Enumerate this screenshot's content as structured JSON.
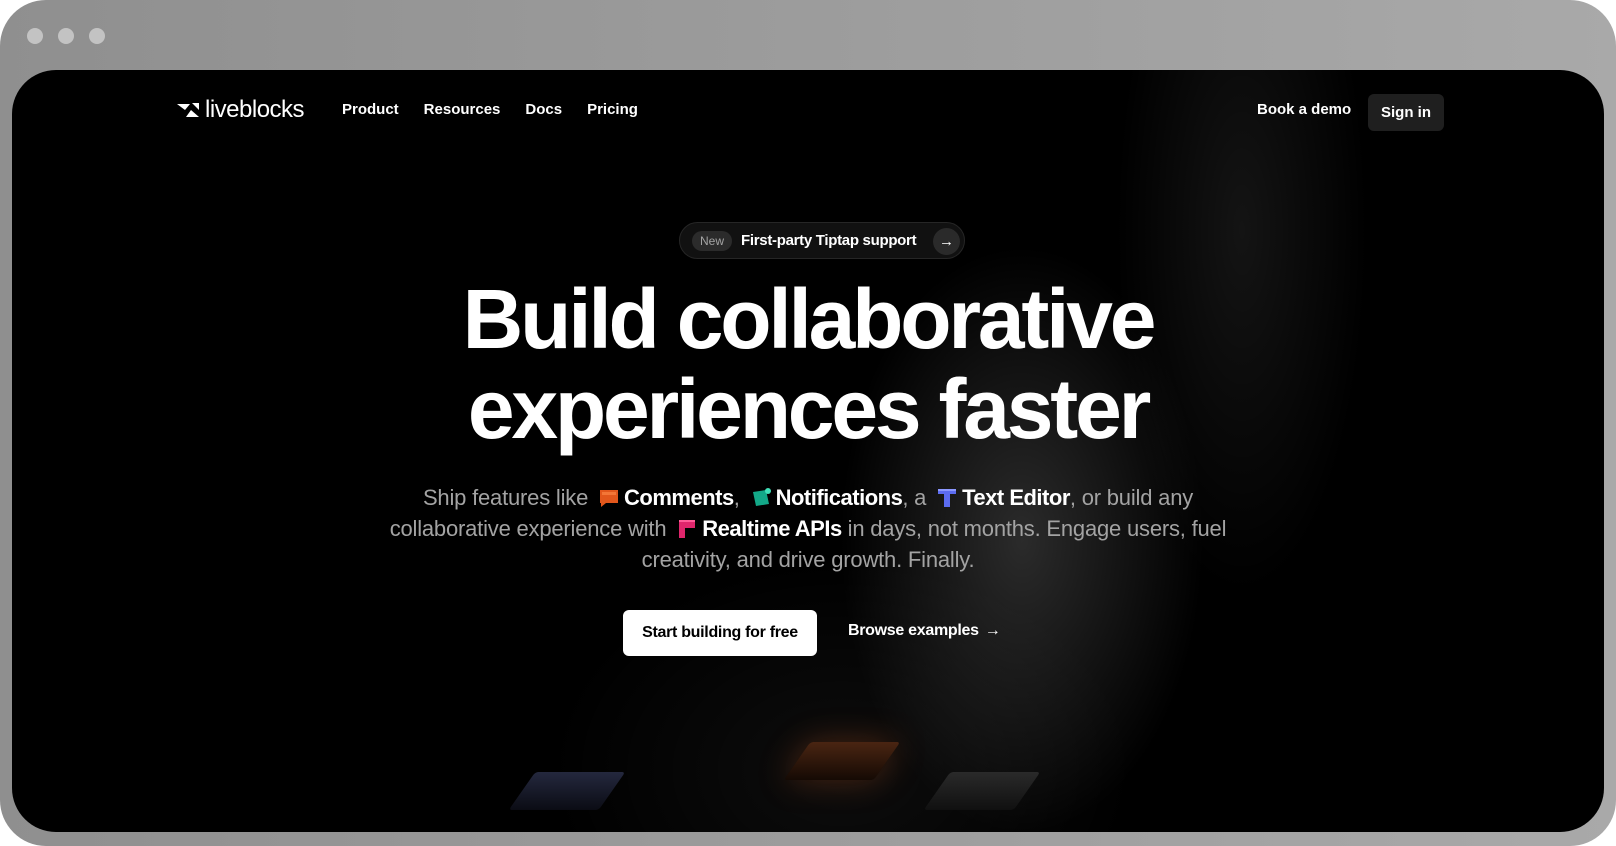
{
  "brand": {
    "name": "liveblocks"
  },
  "nav": {
    "links": [
      "Product",
      "Resources",
      "Docs",
      "Pricing"
    ],
    "book_demo": "Book a demo",
    "sign_in": "Sign in"
  },
  "announcement": {
    "badge": "New",
    "text": "First-party Tiptap support",
    "arrow": "→"
  },
  "hero": {
    "line1": "Build collaborative",
    "line2": "experiences faster"
  },
  "subtitle": {
    "p1": "Ship features like",
    "comments": "Comments",
    "p2": ",",
    "notifications": "Notifications",
    "p3": ", a",
    "text_editor": "Text Editor",
    "p4": ", or build any collaborative experience with",
    "realtime": "Realtime APIs",
    "p5": " in days, not months. Engage users, fuel creativity, and drive growth. Finally."
  },
  "cta": {
    "primary": "Start building for free",
    "secondary": "Browse examples",
    "secondary_arrow": "→"
  },
  "colors": {
    "comments_icon": "#e2571c",
    "notifications_icon": "#13a888",
    "text_editor_icon": "#5c6cf0",
    "realtime_icon": "#e0266c"
  }
}
